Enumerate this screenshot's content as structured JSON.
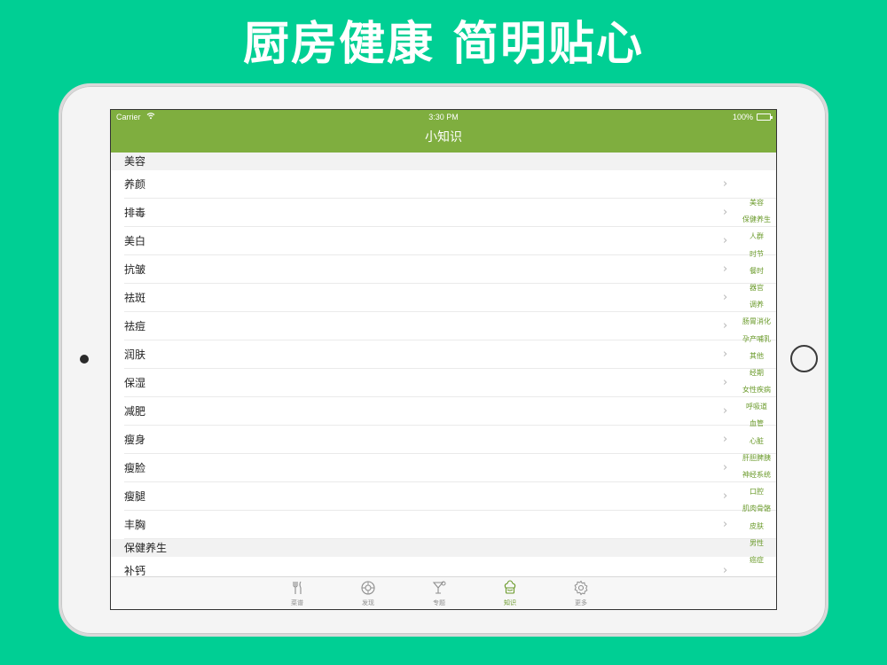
{
  "headline": "厨房健康 简明贴心",
  "status_bar": {
    "carrier": "Carrier",
    "time": "3:30 PM",
    "battery": "100%"
  },
  "nav": {
    "title": "小知识"
  },
  "sections": [
    {
      "title": "美容",
      "items": [
        "养颜",
        "排毒",
        "美白",
        "抗皱",
        "祛斑",
        "祛痘",
        "润肤",
        "保湿",
        "减肥",
        "瘦身",
        "瘦脸",
        "瘦腿",
        "丰胸"
      ]
    },
    {
      "title": "保健养生",
      "items": [
        "补钙"
      ]
    }
  ],
  "index_list": [
    "美容",
    "保健养生",
    "人群",
    "时节",
    "餐时",
    "器官",
    "调养",
    "肠胃消化",
    "孕产哺乳",
    "其他",
    "经期",
    "女性疾病",
    "呼吸道",
    "血管",
    "心脏",
    "肝胆脾胰",
    "神经系统",
    "口腔",
    "肌肉骨骼",
    "皮肤",
    "男性",
    "癌症"
  ],
  "tabs": [
    {
      "label": "菜谱",
      "icon": "fork-knife-icon",
      "active": false
    },
    {
      "label": "发现",
      "icon": "discover-icon",
      "active": false
    },
    {
      "label": "专题",
      "icon": "cocktail-icon",
      "active": false
    },
    {
      "label": "知识",
      "icon": "chef-hat-icon",
      "active": true
    },
    {
      "label": "更多",
      "icon": "gear-icon",
      "active": false
    }
  ],
  "colors": {
    "background": "#00CF94",
    "nav_bar": "#7FAE3F",
    "accent": "#6A9A2A",
    "inactive_tab": "#8e8e8e"
  }
}
